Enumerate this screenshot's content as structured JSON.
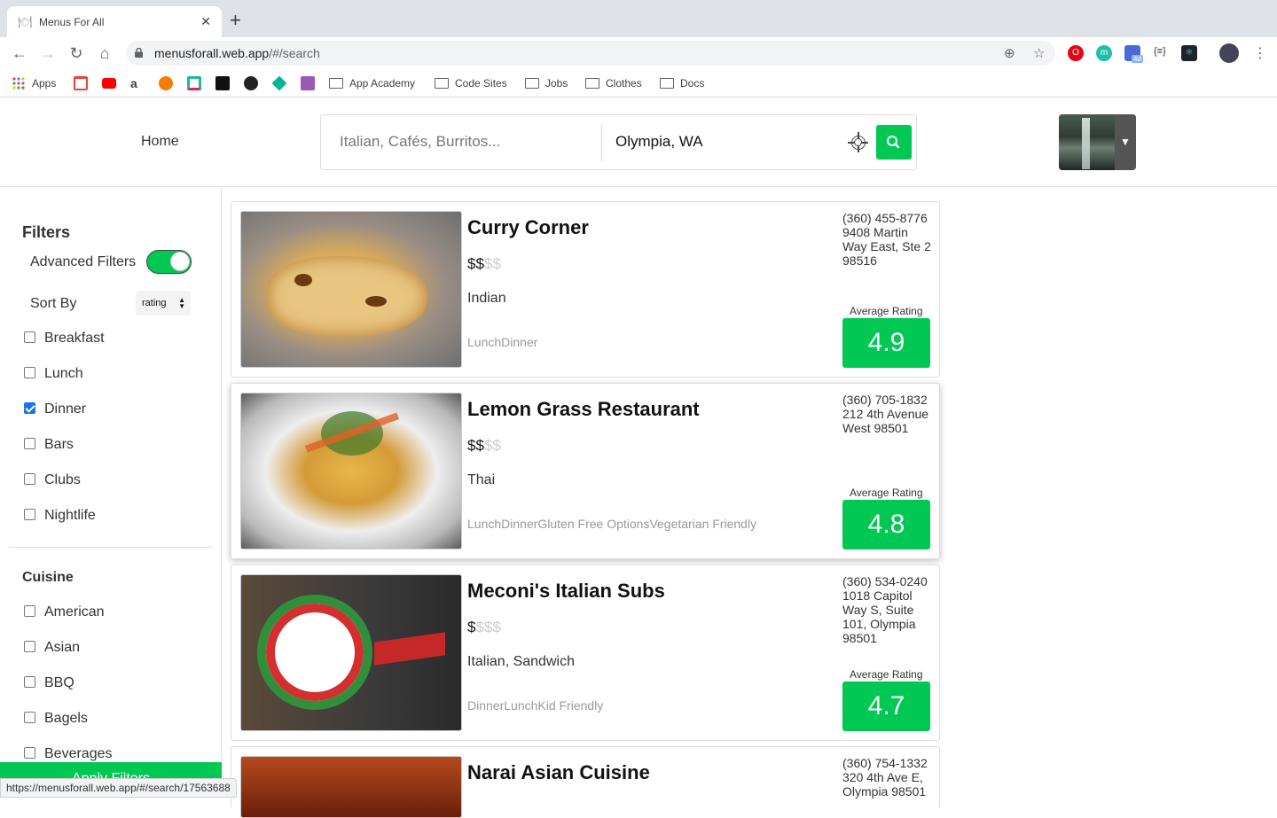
{
  "browser": {
    "tab_title": "Menus For All",
    "url_host": "menusforall.web.app",
    "url_path": "/#/search",
    "ext_badge": "4d",
    "bookmarks": [
      "Apps",
      "App Academy",
      "Code Sites",
      "Jobs",
      "Clothes",
      "Docs"
    ]
  },
  "header": {
    "home": "Home",
    "search_placeholder": "Italian, Cafés, Burritos...",
    "location": "Olympia, WA"
  },
  "sidebar": {
    "filters_title": "Filters",
    "advanced_label": "Advanced Filters",
    "advanced_on": true,
    "sort_label": "Sort By",
    "sort_value": "rating",
    "meals": [
      {
        "label": "Breakfast",
        "checked": false
      },
      {
        "label": "Lunch",
        "checked": false
      },
      {
        "label": "Dinner",
        "checked": true
      },
      {
        "label": "Bars",
        "checked": false
      },
      {
        "label": "Clubs",
        "checked": false
      },
      {
        "label": "Nightlife",
        "checked": false
      }
    ],
    "cuisine_title": "Cuisine",
    "cuisines": [
      {
        "label": "American",
        "checked": false
      },
      {
        "label": "Asian",
        "checked": false
      },
      {
        "label": "BBQ",
        "checked": false
      },
      {
        "label": "Bagels",
        "checked": false
      },
      {
        "label": "Beverages",
        "checked": false
      }
    ],
    "apply": "Apply Filters"
  },
  "status_url": "https://menusforall.web.app/#/search/17563688",
  "results": {
    "avg_label": "Average Rating",
    "items": [
      {
        "name": "Curry Corner",
        "price_on": "$$",
        "price_off": "$$",
        "category": "Indian",
        "tags": "LunchDinner",
        "phone": "(360) 455-8776",
        "address": "9408 Martin Way East, Ste 2 98516",
        "rating": "4.9"
      },
      {
        "name": "Lemon Grass Restaurant",
        "price_on": "$$",
        "price_off": "$$",
        "category": "Thai",
        "tags": "LunchDinnerGluten Free OptionsVegetarian Friendly",
        "phone": "(360) 705-1832",
        "address": "212 4th Avenue West 98501",
        "rating": "4.8"
      },
      {
        "name": "Meconi's Italian Subs",
        "price_on": "$",
        "price_off": "$$$",
        "category": "Italian, Sandwich",
        "tags": "DinnerLunchKid Friendly",
        "phone": "(360) 534-0240",
        "address": "1018 Capitol Way S, Suite 101, Olympia 98501",
        "rating": "4.7"
      },
      {
        "name": "Narai Asian Cuisine",
        "phone": "(360) 754-1332",
        "address": "320 4th Ave E, Olympia 98501"
      }
    ]
  },
  "colors": {
    "accent": "#00c853",
    "checkbox": "#1a73e8"
  }
}
